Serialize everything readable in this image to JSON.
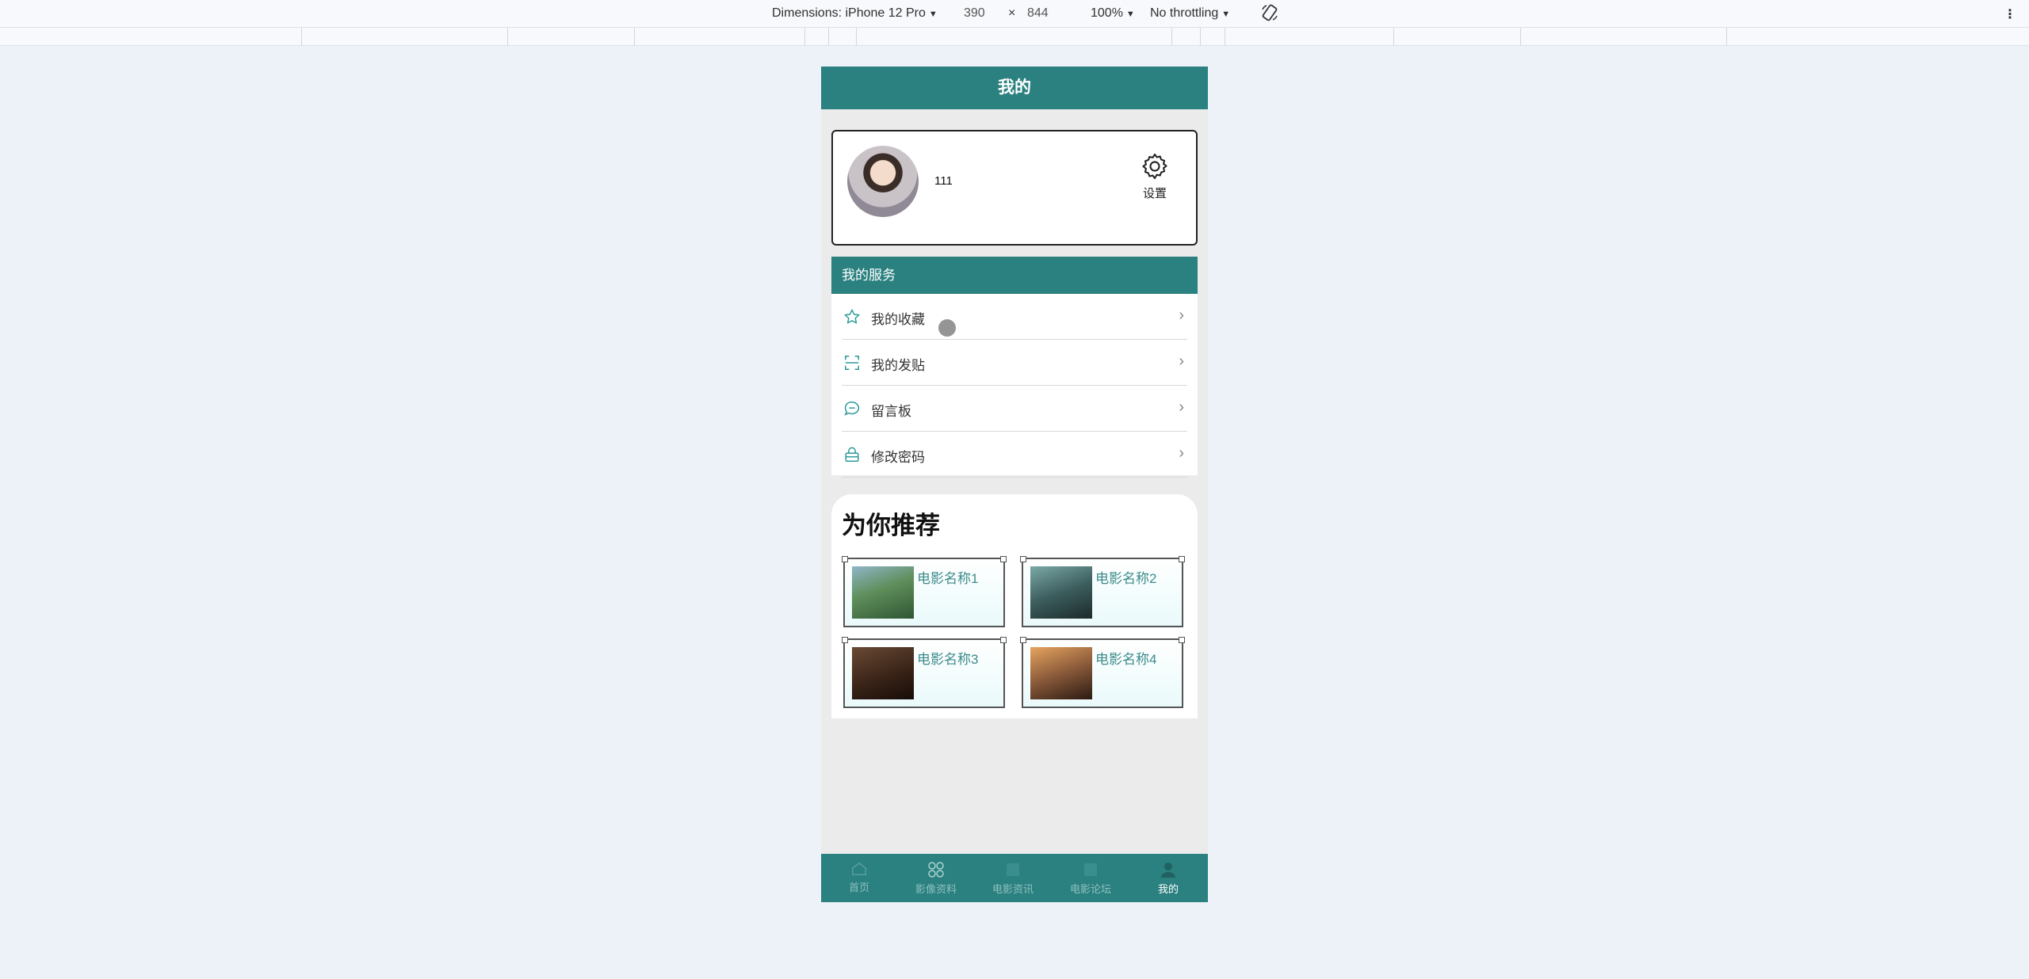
{
  "devtools": {
    "dimensions_label": "Dimensions: iPhone 12 Pro",
    "width": "390",
    "times": "×",
    "height": "844",
    "zoom": "100%",
    "throttling": "No throttling"
  },
  "header": {
    "title": "我的"
  },
  "profile": {
    "username": "111",
    "settings_label": "设置"
  },
  "services": {
    "title": "我的服务",
    "items": [
      {
        "label": "我的收藏",
        "icon": "star-icon"
      },
      {
        "label": "我的发贴",
        "icon": "scan-icon"
      },
      {
        "label": "留言板",
        "icon": "message-icon"
      },
      {
        "label": "修改密码",
        "icon": "lock-icon"
      }
    ]
  },
  "recommend": {
    "title": "为你推荐",
    "movies": [
      {
        "name": "电影名称1"
      },
      {
        "name": "电影名称2"
      },
      {
        "name": "电影名称3"
      },
      {
        "name": "电影名称4"
      }
    ]
  },
  "tabbar": {
    "items": [
      {
        "label": "首页"
      },
      {
        "label": "影像资料"
      },
      {
        "label": "电影资讯"
      },
      {
        "label": "电影论坛"
      },
      {
        "label": "我的"
      }
    ],
    "active": 4
  },
  "colors": {
    "primary": "#2b8180",
    "accent_text": "#3b8a8a"
  }
}
